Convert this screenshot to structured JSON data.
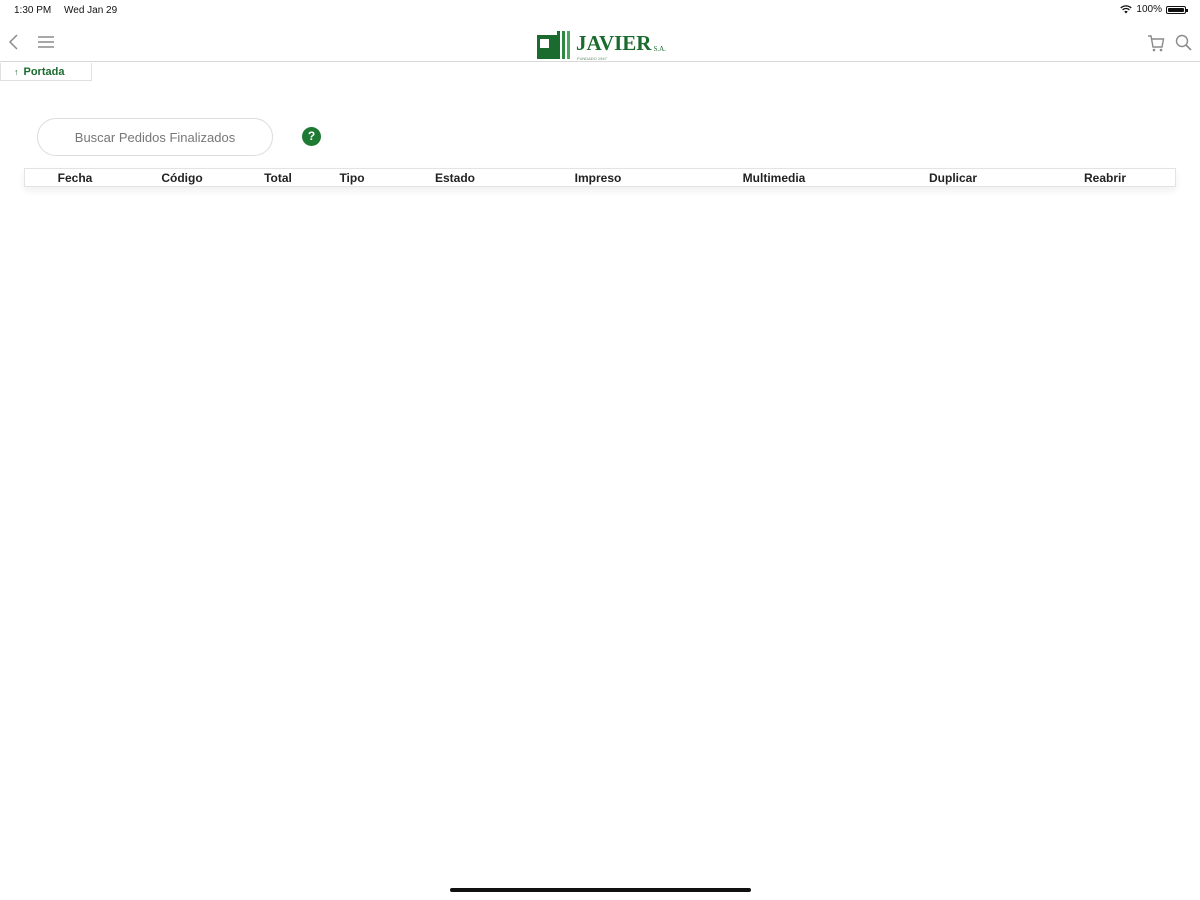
{
  "status_bar": {
    "time": "1:30 PM",
    "date": "Wed Jan 29",
    "battery_text": "100%",
    "battery_level": 1.0
  },
  "nav": {
    "logo_text": "JAVIER",
    "logo_suffix": "S.A.",
    "logo_tagline": "FUNDADO 1947",
    "brand_color": "#1b6b2e",
    "icons": [
      "back-icon",
      "menu-icon",
      "cart-icon",
      "search-icon"
    ]
  },
  "breadcrumb": {
    "label": "Portada"
  },
  "search": {
    "placeholder": "Buscar Pedidos Finalizados",
    "value": ""
  },
  "help": {
    "label": "?",
    "color": "#1e7a32"
  },
  "table": {
    "columns": [
      "Fecha",
      "Código",
      "Total",
      "Tipo",
      "Estado",
      "Impreso",
      "Multimedia",
      "Duplicar",
      "Reabrir"
    ],
    "rows": []
  }
}
